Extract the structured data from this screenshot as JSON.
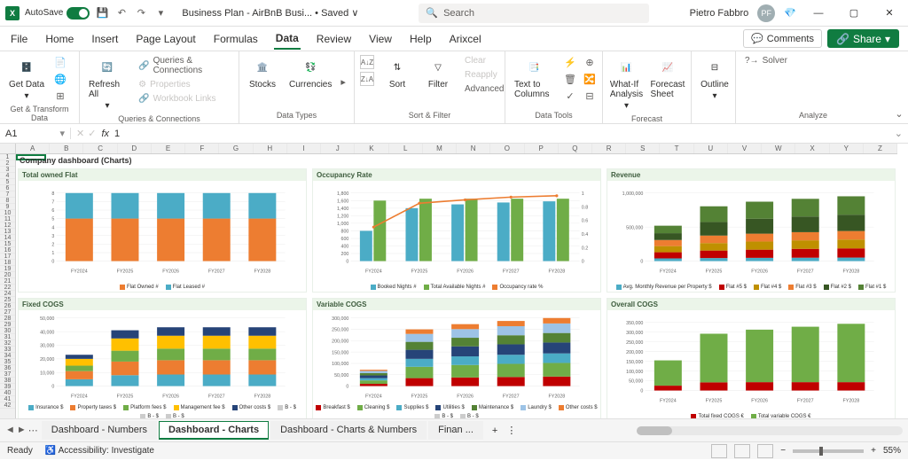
{
  "titlebar": {
    "autosave_label": "AutoSave",
    "doc_title": "Business Plan - AirBnB Busi... • Saved ∨",
    "search_placeholder": "Search",
    "user_name": "Pietro Fabbro",
    "user_initials": "PF"
  },
  "menu": [
    "File",
    "Home",
    "Insert",
    "Page Layout",
    "Formulas",
    "Data",
    "Review",
    "View",
    "Help",
    "Arixcel"
  ],
  "menu_active": 5,
  "comments_btn": "Comments",
  "share_btn": "Share",
  "ribbon": {
    "groups": [
      {
        "label": "Get & Transform Data",
        "items": [
          "Get Data"
        ]
      },
      {
        "label": "Queries & Connections",
        "refresh": "Refresh All",
        "items": [
          "Queries & Connections",
          "Properties",
          "Workbook Links"
        ]
      },
      {
        "label": "Data Types",
        "items": [
          "Stocks",
          "Currencies"
        ]
      },
      {
        "label": "Sort & Filter",
        "items": [
          "Sort",
          "Filter"
        ],
        "sub": [
          "Clear",
          "Reapply",
          "Advanced"
        ]
      },
      {
        "label": "Data Tools",
        "main": "Text to Columns"
      },
      {
        "label": "Forecast",
        "items": [
          "What-If Analysis",
          "Forecast Sheet"
        ]
      },
      {
        "label": "Outline",
        "main": "Outline"
      },
      {
        "label": "Analyze",
        "solver": "Solver"
      }
    ]
  },
  "namebox": "A1",
  "formula_value": "1",
  "columns": [
    "A",
    "B",
    "C",
    "D",
    "E",
    "F",
    "G",
    "H",
    "I",
    "J",
    "K",
    "L",
    "M",
    "N",
    "O",
    "P",
    "Q",
    "R",
    "S",
    "T",
    "U",
    "V",
    "W",
    "X",
    "Y",
    "Z"
  ],
  "rows": [
    "1",
    "2",
    "3",
    "4",
    "5",
    "6",
    "7",
    "8",
    "9",
    "10",
    "11",
    "12",
    "13",
    "14",
    "15",
    "16",
    "17",
    "18",
    "19",
    "20",
    "21",
    "22",
    "24",
    "25",
    "26",
    "27",
    "28",
    "29",
    "30",
    "31",
    "32",
    "33",
    "34",
    "35",
    "36",
    "37",
    "38",
    "39",
    "40",
    "41",
    "42"
  ],
  "dash_title": "Company dashboard (Charts)",
  "sheet_tabs": [
    "Dashboard - Numbers",
    "Dashboard - Charts",
    "Dashboard - Charts & Numbers",
    "Finan ..."
  ],
  "sheet_active": 1,
  "status": {
    "ready": "Ready",
    "accessibility": "Accessibility: Investigate",
    "zoom": "55%"
  },
  "chart_data": [
    {
      "title": "Total owned Flat",
      "type": "bar",
      "categories": [
        "FY2024",
        "FY2025",
        "FY2026",
        "FY2027",
        "FY2028"
      ],
      "series": [
        {
          "name": "Flat Owned #",
          "values": [
            5,
            5,
            5,
            5,
            5
          ],
          "color": "#ed7d31"
        },
        {
          "name": "Flat Leased #",
          "values": [
            3,
            3,
            3,
            3,
            3
          ],
          "color": "#4bacc6"
        }
      ],
      "ylim": [
        0,
        8
      ],
      "yticks": [
        0,
        1,
        2,
        3,
        4,
        5,
        6,
        7,
        8
      ],
      "stacked": true
    },
    {
      "title": "Occupancy Rate",
      "type": "combo",
      "categories": [
        "FY2024",
        "FY2025",
        "FY2026",
        "FY2027",
        "FY2028"
      ],
      "series": [
        {
          "name": "Booked Nights #",
          "values": [
            800,
            1400,
            1500,
            1550,
            1580
          ],
          "color": "#4bacc6",
          "type": "bar"
        },
        {
          "name": "Total Available Nights #",
          "values": [
            1600,
            1650,
            1650,
            1650,
            1650
          ],
          "color": "#70ad47",
          "type": "bar"
        },
        {
          "name": "Occupancy rate %",
          "values": [
            0.5,
            0.85,
            0.9,
            0.94,
            0.96
          ],
          "color": "#ed7d31",
          "type": "line",
          "axis": "right"
        }
      ],
      "ylim": [
        0,
        1800
      ],
      "yticks": [
        0,
        200,
        400,
        600,
        800,
        1000,
        1200,
        1400,
        1600,
        1800
      ],
      "ylim2": [
        0,
        1
      ],
      "yticks2": [
        0,
        0.2,
        0.4,
        0.6,
        0.8,
        1
      ]
    },
    {
      "title": "Revenue",
      "type": "bar",
      "categories": [
        "FY2024",
        "FY2025",
        "FY2026",
        "FY2027",
        "FY2028"
      ],
      "series": [
        {
          "name": "Avg. Monthly Revenue per Property $",
          "values": [
            40000,
            45000,
            48000,
            50000,
            52000
          ],
          "color": "#4bacc6"
        },
        {
          "name": "Flat #5 $",
          "values": [
            90000,
            110000,
            120000,
            130000,
            135000
          ],
          "color": "#c00000"
        },
        {
          "name": "Flat #4 $",
          "values": [
            90000,
            110000,
            120000,
            125000,
            130000
          ],
          "color": "#bf9000"
        },
        {
          "name": "Flat #3 $",
          "values": [
            90000,
            110000,
            115000,
            120000,
            125000
          ],
          "color": "#ed7d31"
        },
        {
          "name": "Flat #2 $",
          "values": [
            100000,
            200000,
            220000,
            230000,
            240000
          ],
          "color": "#375623"
        },
        {
          "name": "Flat #1 $",
          "values": [
            110000,
            230000,
            250000,
            260000,
            270000
          ],
          "color": "#548235"
        }
      ],
      "ylim": [
        0,
        1000000
      ],
      "yticks": [
        0,
        500000,
        1000000
      ],
      "stacked": true
    },
    {
      "title": "Fixed COGS",
      "type": "bar",
      "categories": [
        "FY2024",
        "FY2025",
        "FY2026",
        "FY2027",
        "FY2028"
      ],
      "series": [
        {
          "name": "Insurance $",
          "values": [
            5000,
            8000,
            8500,
            8500,
            8500
          ],
          "color": "#4bacc6"
        },
        {
          "name": "Property taxes $",
          "values": [
            6000,
            10000,
            10500,
            10500,
            10500
          ],
          "color": "#ed7d31"
        },
        {
          "name": "Platform fees $",
          "values": [
            4000,
            8000,
            8500,
            8500,
            8500
          ],
          "color": "#70ad47"
        },
        {
          "name": "Management fee $",
          "values": [
            5000,
            9000,
            9500,
            9500,
            9500
          ],
          "color": "#ffc000"
        },
        {
          "name": "Other costs $",
          "values": [
            3000,
            6000,
            6200,
            6200,
            6200
          ],
          "color": "#264478"
        }
      ],
      "ylim": [
        0,
        50000
      ],
      "yticks": [
        0,
        10000,
        20000,
        30000,
        40000,
        50000
      ],
      "stacked": true,
      "extra_legend": [
        "B - $",
        "B - $",
        "B - $"
      ]
    },
    {
      "title": "Variable COGS",
      "type": "bar",
      "categories": [
        "FY2024",
        "FY2025",
        "FY2026",
        "FY2027",
        "FY2028"
      ],
      "series": [
        {
          "name": "Breakfast $",
          "values": [
            10000,
            35000,
            38000,
            40000,
            42000
          ],
          "color": "#c00000"
        },
        {
          "name": "Cleaning $",
          "values": [
            15000,
            50000,
            55000,
            58000,
            60000
          ],
          "color": "#70ad47"
        },
        {
          "name": "Supplies $",
          "values": [
            10000,
            35000,
            38000,
            40000,
            42000
          ],
          "color": "#4bacc6"
        },
        {
          "name": "Utilities $",
          "values": [
            12000,
            40000,
            44000,
            46000,
            48000
          ],
          "color": "#264478"
        },
        {
          "name": "Maintenance $",
          "values": [
            10000,
            35000,
            38000,
            40000,
            42000
          ],
          "color": "#548235"
        },
        {
          "name": "Laundry $",
          "values": [
            10000,
            35000,
            38000,
            40000,
            42000
          ],
          "color": "#9dc3e6"
        },
        {
          "name": "Other costs $",
          "values": [
            5000,
            20000,
            22000,
            23000,
            24000
          ],
          "color": "#ed7d31"
        }
      ],
      "ylim": [
        0,
        300000
      ],
      "yticks": [
        0,
        50000,
        100000,
        150000,
        200000,
        250000,
        300000
      ],
      "stacked": true,
      "extra_legend": [
        "B - $",
        "B - $"
      ]
    },
    {
      "title": "Overall COGS",
      "type": "bar",
      "categories": [
        "FY2024",
        "FY2025",
        "FY2026",
        "FY2027",
        "FY2028"
      ],
      "series": [
        {
          "name": "Total fixed COGS €",
          "values": [
            25000,
            42000,
            43000,
            43000,
            43000
          ],
          "color": "#c00000"
        },
        {
          "name": "Total variable COGS €",
          "values": [
            130000,
            250000,
            270000,
            285000,
            300000
          ],
          "color": "#70ad47"
        }
      ],
      "ylim": [
        0,
        350000
      ],
      "yticks": [
        0,
        50000,
        100000,
        150000,
        200000,
        250000,
        300000,
        350000
      ],
      "stacked": true
    }
  ]
}
